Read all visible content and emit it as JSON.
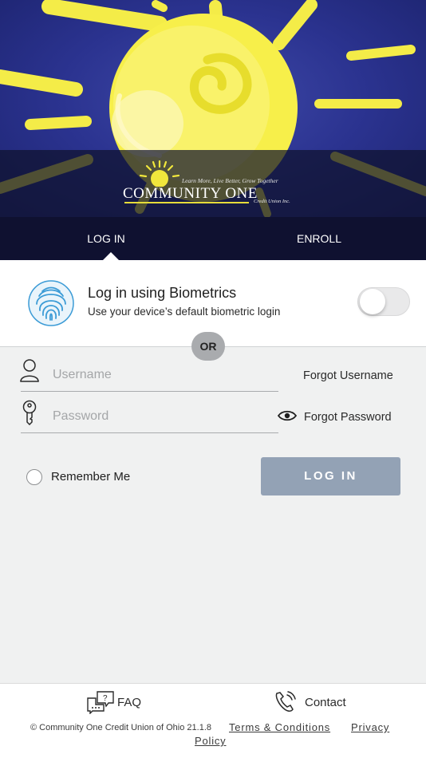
{
  "branding": {
    "tagline": "Learn More, Live Better, Grow Together",
    "name": "COMMUNITY ONE",
    "sub": "Credit Union Inc."
  },
  "tabs": [
    {
      "label": "LOG IN",
      "active": true
    },
    {
      "label": "ENROLL",
      "active": false
    }
  ],
  "biometrics": {
    "icon": "fingerprint-icon",
    "title": "Log in using Biometrics",
    "subtitle": "Use your device’s default biometric login",
    "toggle_on": false
  },
  "divider": {
    "label": "OR"
  },
  "form": {
    "username_placeholder": "Username",
    "password_placeholder": "Password",
    "forgot_username": "Forgot Username",
    "forgot_password": "Forgot Password",
    "remember_me": "Remember Me",
    "login_button": "LOG IN"
  },
  "footer": {
    "faq": "FAQ",
    "contact": "Contact",
    "copyright": "© Community One Credit Union of Ohio 21.1.8",
    "terms": "Terms & Conditions",
    "privacy_line1": "Privacy",
    "privacy_line2": "Policy"
  },
  "colors": {
    "hero_blue": "#2b3390",
    "tab_bar": "#0f1130",
    "sun_yellow": "#f7ef4a",
    "login_button": "#93a2b5",
    "fingerprint": "#3b9bd6",
    "background": "#f0f1f1"
  }
}
